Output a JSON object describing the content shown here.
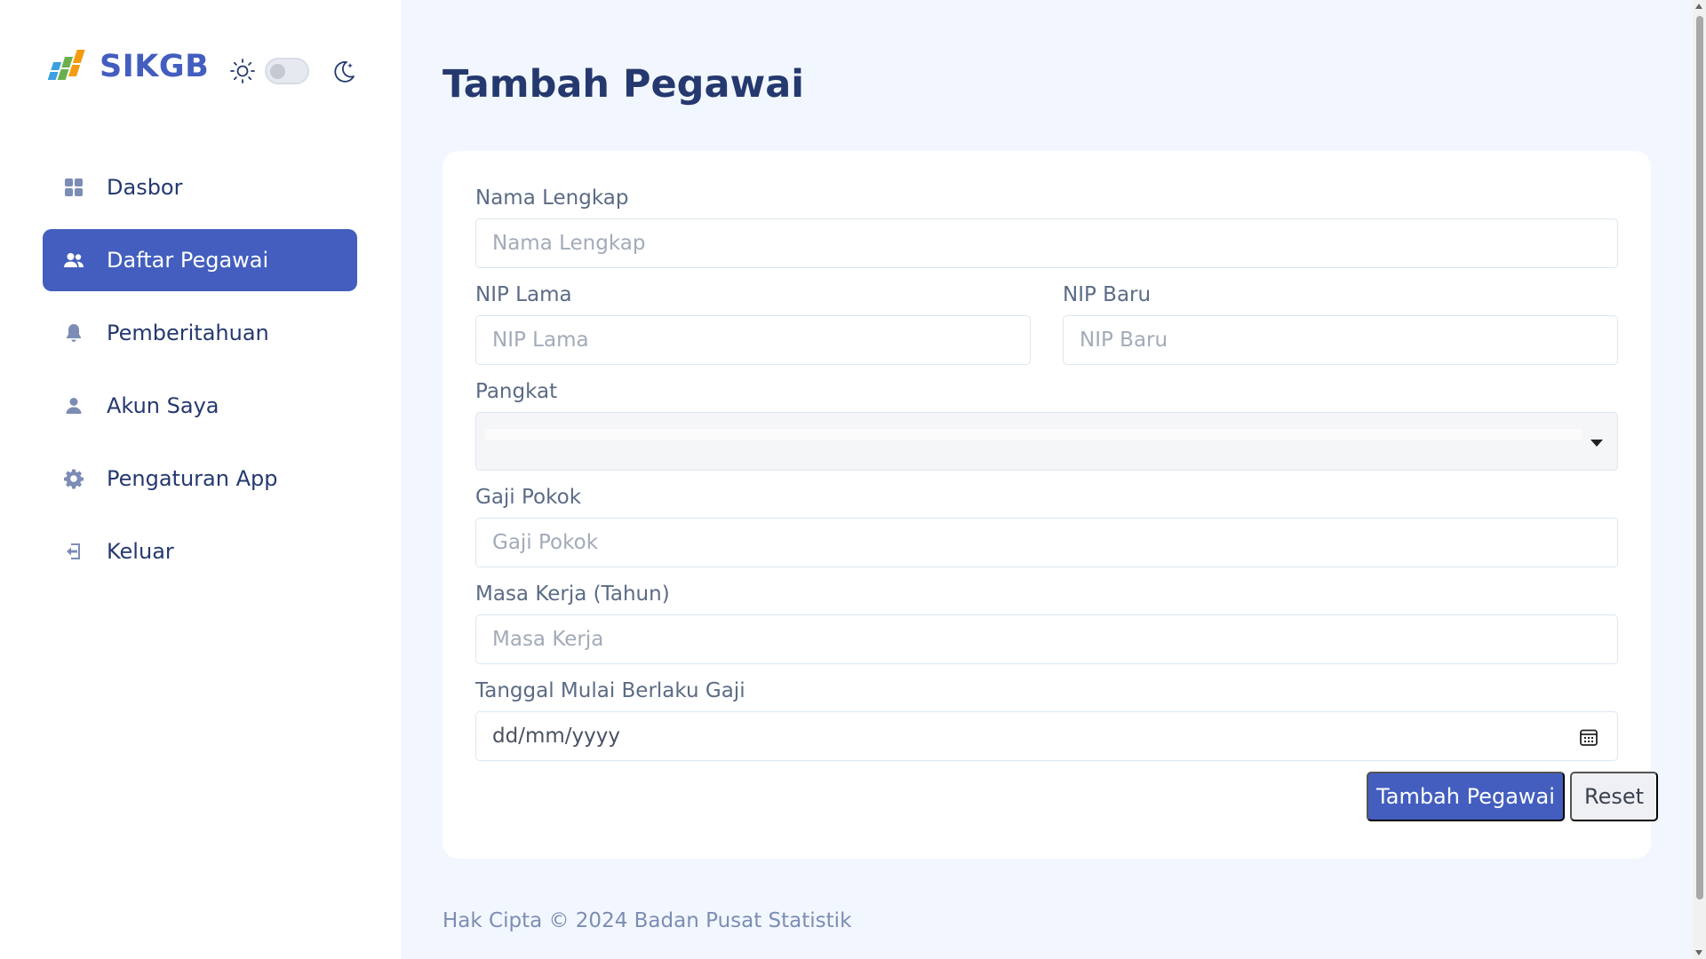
{
  "brand": {
    "name": "SIKGB",
    "icon": "bps-logo-icon"
  },
  "theme_toggle": {
    "light_icon": "sun-icon",
    "dark_icon": "moon-icon",
    "dark_mode": false
  },
  "sidebar": {
    "items": [
      {
        "label": "Dasbor",
        "icon": "grid-icon",
        "active": false
      },
      {
        "label": "Daftar Pegawai",
        "icon": "users-icon",
        "active": true
      },
      {
        "label": "Pemberitahuan",
        "icon": "bell-icon",
        "active": false
      },
      {
        "label": "Akun Saya",
        "icon": "user-icon",
        "active": false
      },
      {
        "label": "Pengaturan App",
        "icon": "gear-icon",
        "active": false
      },
      {
        "label": "Keluar",
        "icon": "logout-icon",
        "active": false
      }
    ]
  },
  "page": {
    "title": "Tambah Pegawai"
  },
  "form": {
    "nama": {
      "label": "Nama Lengkap",
      "placeholder": "Nama Lengkap",
      "value": ""
    },
    "nip_lama": {
      "label": "NIP Lama",
      "placeholder": "NIP Lama",
      "value": ""
    },
    "nip_baru": {
      "label": "NIP Baru",
      "placeholder": "NIP Baru",
      "value": ""
    },
    "pangkat": {
      "label": "Pangkat",
      "value": ""
    },
    "gaji": {
      "label": "Gaji Pokok",
      "placeholder": "Gaji Pokok",
      "value": ""
    },
    "masa_kerja": {
      "label": "Masa Kerja (Tahun)",
      "placeholder": "Masa Kerja",
      "value": ""
    },
    "tanggal": {
      "label": "Tanggal Mulai Berlaku Gaji",
      "value": "dd/mm/yyyy",
      "icon": "calendar-icon"
    },
    "submit_label": "Tambah Pegawai",
    "reset_label": "Reset"
  },
  "footer": {
    "text": "Hak Cipta © 2024 Badan Pusat Statistik"
  },
  "colors": {
    "primary": "#435ebe",
    "heading": "#25396f",
    "background": "#f2f7ff"
  }
}
